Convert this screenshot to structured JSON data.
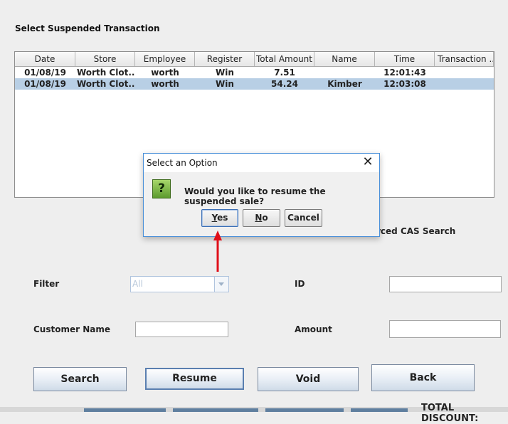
{
  "section_title": "Select Suspended Transaction",
  "table": {
    "columns": [
      "Date",
      "Store",
      "Employee",
      "Register",
      "Total Amount",
      "Name",
      "Time",
      "Transaction ..."
    ],
    "rows": [
      [
        "01/08/19",
        "Worth Clot...",
        "worth",
        "Win",
        "7.51",
        "",
        "12:01:43",
        ""
      ],
      [
        "01/08/19",
        "Worth Clot...",
        "worth",
        "Win",
        "54.24",
        "Kimber",
        "12:03:08",
        ""
      ]
    ],
    "selected_row": 1
  },
  "enforced_search_label": "rced CAS Search",
  "form": {
    "filter_label": "Filter",
    "filter_value": "All",
    "id_label": "ID",
    "id_value": "",
    "customer_name_label": "Customer Name",
    "customer_name_value": "",
    "amount_label": "Amount",
    "amount_value": ""
  },
  "buttons": {
    "search": "Search",
    "resume": "Resume",
    "void": "Void",
    "back": "Back"
  },
  "dialog": {
    "title": "Select an Option",
    "close_glyph": "✕",
    "icon_glyph": "?",
    "message": "Would you like to resume the suspended sale?",
    "yes_first": "Y",
    "yes_rest": "es",
    "no_first": "N",
    "no_rest": "o",
    "cancel": "Cancel"
  },
  "footer_cut_text": "TOTAL DISCOUNT:",
  "colors": {
    "selection": "#b8cfe5",
    "dialog_border": "#4a90d9",
    "annotation_arrow": "#e0101a"
  }
}
